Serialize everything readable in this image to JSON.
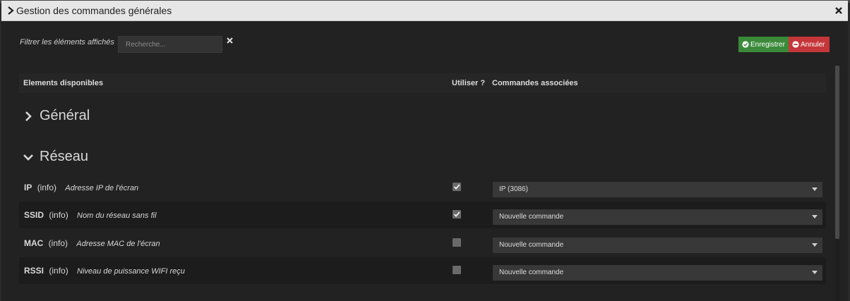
{
  "dialog": {
    "title": "Gestion des commandes générales"
  },
  "filter": {
    "label": "Filtrer les éléments affichés",
    "placeholder": "Recherche...",
    "value": ""
  },
  "actions": {
    "save_label": "Enregistrer",
    "cancel_label": "Annuler"
  },
  "table": {
    "headers": {
      "elements": "Elements disponibles",
      "use": "Utiliser ?",
      "commands": "Commandes associées"
    }
  },
  "sections": [
    {
      "label": "Général",
      "expanded": false
    },
    {
      "label": "Réseau",
      "expanded": true
    }
  ],
  "rows": [
    {
      "name": "IP",
      "type": "(info)",
      "description": "Adresse IP de l'écran",
      "checked": true,
      "command": "IP (3086)"
    },
    {
      "name": "SSID",
      "type": "(info)",
      "description": "Nom du réseau sans fil",
      "checked": true,
      "command": "Nouvelle commande"
    },
    {
      "name": "MAC",
      "type": "(info)",
      "description": "Adresse MAC de l'écran",
      "checked": false,
      "command": "Nouvelle commande"
    },
    {
      "name": "RSSI",
      "type": "(info)",
      "description": "Niveau de puissance WIFI reçu",
      "checked": false,
      "command": "Nouvelle commande"
    }
  ],
  "colors": {
    "save": "#3a8a3a",
    "cancel": "#c4363a",
    "titlebar": "#e6e6e6",
    "background": "#222222"
  },
  "icons": {
    "title": "chevron-right-icon",
    "close": "close-icon",
    "clear": "clear-icon",
    "save": "check-circle-icon",
    "cancel": "minus-circle-icon",
    "check": "check-icon"
  }
}
